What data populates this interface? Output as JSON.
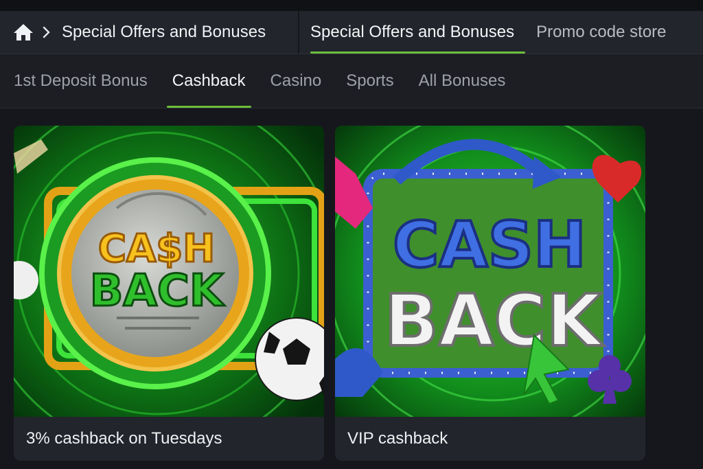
{
  "breadcrumb": {
    "home_icon": "home-icon",
    "separator_icon": "chevron-right-icon",
    "label": "Special Offers and Bonuses"
  },
  "top_tabs": [
    {
      "label": "Special Offers and Bonuses",
      "active": true
    },
    {
      "label": "Promo code store",
      "active": false
    }
  ],
  "sub_tabs": [
    {
      "label": "1st Deposit Bonus",
      "active": false
    },
    {
      "label": "Cashback",
      "active": true
    },
    {
      "label": "Casino",
      "active": false
    },
    {
      "label": "Sports",
      "active": false
    },
    {
      "label": "All Bonuses",
      "active": false
    }
  ],
  "cards": [
    {
      "caption": "3% cashback on Tuesdays",
      "banner": {
        "line1": "CA$H",
        "line2": "BACK"
      }
    },
    {
      "caption": "VIP cashback",
      "banner": {
        "line1": "CASH",
        "line2": "BACK"
      }
    }
  ],
  "colors": {
    "background": "#16171c",
    "nav": "#23252c",
    "accent": "#6bbf3a"
  }
}
